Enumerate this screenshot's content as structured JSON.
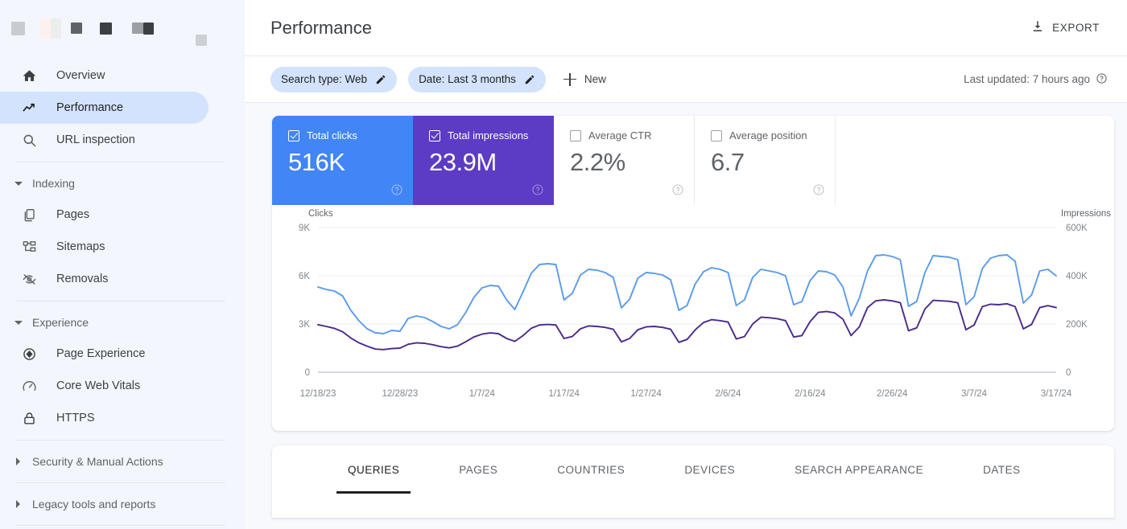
{
  "sidebar": {
    "brand_redacted": true,
    "items": [
      {
        "label": "Overview",
        "icon": "home-icon",
        "selected": false
      },
      {
        "label": "Performance",
        "icon": "trending-up-icon",
        "selected": true
      },
      {
        "label": "URL inspection",
        "icon": "search-icon",
        "selected": false
      }
    ],
    "sections": [
      {
        "label": "Indexing",
        "expanded": true,
        "items": [
          {
            "label": "Pages",
            "icon": "pages-icon"
          },
          {
            "label": "Sitemaps",
            "icon": "sitemap-icon"
          },
          {
            "label": "Removals",
            "icon": "eye-off-icon"
          }
        ]
      },
      {
        "label": "Experience",
        "expanded": true,
        "items": [
          {
            "label": "Page Experience",
            "icon": "page-experience-icon"
          },
          {
            "label": "Core Web Vitals",
            "icon": "speedometer-icon"
          },
          {
            "label": "HTTPS",
            "icon": "lock-icon"
          }
        ]
      },
      {
        "label": "Security & Manual Actions",
        "expanded": false,
        "items": []
      },
      {
        "label": "Legacy tools and reports",
        "expanded": false,
        "items": []
      }
    ]
  },
  "header": {
    "title": "Performance",
    "export_label": "EXPORT",
    "export_icon": "download-icon"
  },
  "filters": {
    "chips": [
      {
        "label": "Search type: Web",
        "icon": "pencil-icon"
      },
      {
        "label": "Date: Last 3 months",
        "icon": "pencil-icon"
      }
    ],
    "new_label": "New",
    "new_icon": "plus-icon",
    "last_updated": "Last updated: 7 hours ago",
    "help_icon": "help-circle-icon"
  },
  "metrics": [
    {
      "label": "Total clicks",
      "value": "516K",
      "checked": true,
      "color": "#4285f4",
      "help_icon": "help-circle-icon"
    },
    {
      "label": "Total impressions",
      "value": "23.9M",
      "checked": true,
      "color": "#5c3cc4",
      "help_icon": "help-circle-icon"
    },
    {
      "label": "Average CTR",
      "value": "2.2%",
      "checked": false,
      "color": "#ffffff",
      "help_icon": "help-circle-icon"
    },
    {
      "label": "Average position",
      "value": "6.7",
      "checked": false,
      "color": "#ffffff",
      "help_icon": "help-circle-icon"
    }
  ],
  "tabs": [
    {
      "label": "QUERIES",
      "active": true
    },
    {
      "label": "PAGES",
      "active": false
    },
    {
      "label": "COUNTRIES",
      "active": false
    },
    {
      "label": "DEVICES",
      "active": false
    },
    {
      "label": "SEARCH APPEARANCE",
      "active": false
    },
    {
      "label": "DATES",
      "active": false
    }
  ],
  "chart_data": {
    "type": "line",
    "title": "",
    "left_axis_label": "Clicks",
    "right_axis_label": "Impressions",
    "left_ticks": [
      "0",
      "3K",
      "6K",
      "9K"
    ],
    "left_tick_values": [
      0,
      3000,
      6000,
      9000
    ],
    "right_ticks": [
      "0",
      "200K",
      "400K",
      "600K"
    ],
    "right_tick_values": [
      0,
      200000,
      400000,
      600000
    ],
    "ylim_left": [
      0,
      9000
    ],
    "ylim_right": [
      0,
      600000
    ],
    "grid": true,
    "legend_position": "none",
    "x_tick_labels": [
      "12/18/23",
      "12/28/23",
      "1/7/24",
      "1/17/24",
      "1/27/24",
      "2/6/24",
      "2/16/24",
      "2/26/24",
      "3/7/24",
      "3/17/24"
    ],
    "x_tick_indices": [
      0,
      10,
      20,
      30,
      40,
      50,
      60,
      70,
      80,
      90
    ],
    "series": [
      {
        "name": "Clicks",
        "color": "#5b9be8",
        "axis": "left",
        "values": [
          5300,
          5150,
          5050,
          4750,
          3850,
          3200,
          2700,
          2450,
          2400,
          2600,
          2550,
          3350,
          3500,
          3400,
          3150,
          2850,
          2700,
          2950,
          3700,
          4650,
          5250,
          5400,
          5350,
          4500,
          3900,
          5000,
          6150,
          6700,
          6750,
          6700,
          4500,
          4900,
          6050,
          6400,
          6350,
          6200,
          5900,
          4000,
          4550,
          5850,
          6200,
          6150,
          6050,
          5750,
          3850,
          4150,
          5500,
          6250,
          6500,
          6400,
          6200,
          4150,
          4500,
          5900,
          6400,
          6300,
          6200,
          6000,
          4200,
          4400,
          5700,
          6300,
          6250,
          6050,
          5300,
          3500,
          4600,
          6300,
          7250,
          7300,
          7200,
          7000,
          4100,
          4400,
          6200,
          7250,
          7200,
          7150,
          7000,
          4200,
          4700,
          6450,
          7100,
          7250,
          7300,
          6900,
          4300,
          4800,
          6300,
          6400,
          6000
        ]
      },
      {
        "name": "Impressions",
        "color": "#4a2a8a",
        "axis": "right",
        "values": [
          197000,
          190000,
          182000,
          168000,
          142000,
          122000,
          108000,
          96000,
          94000,
          98000,
          100000,
          116000,
          122000,
          120000,
          114000,
          106000,
          101000,
          108000,
          126000,
          146000,
          158000,
          163000,
          160000,
          140000,
          128000,
          152000,
          182000,
          196000,
          198000,
          196000,
          140000,
          148000,
          180000,
          192000,
          190000,
          186000,
          178000,
          126000,
          140000,
          176000,
          188000,
          190000,
          186000,
          178000,
          124000,
          136000,
          176000,
          206000,
          218000,
          214000,
          208000,
          138000,
          148000,
          200000,
          228000,
          226000,
          222000,
          214000,
          146000,
          152000,
          210000,
          248000,
          252000,
          246000,
          220000,
          152000,
          188000,
          268000,
          296000,
          300000,
          296000,
          288000,
          172000,
          184000,
          262000,
          298000,
          296000,
          294000,
          288000,
          176000,
          196000,
          272000,
          282000,
          280000,
          284000,
          272000,
          180000,
          198000,
          268000,
          276000,
          268000
        ]
      }
    ]
  }
}
